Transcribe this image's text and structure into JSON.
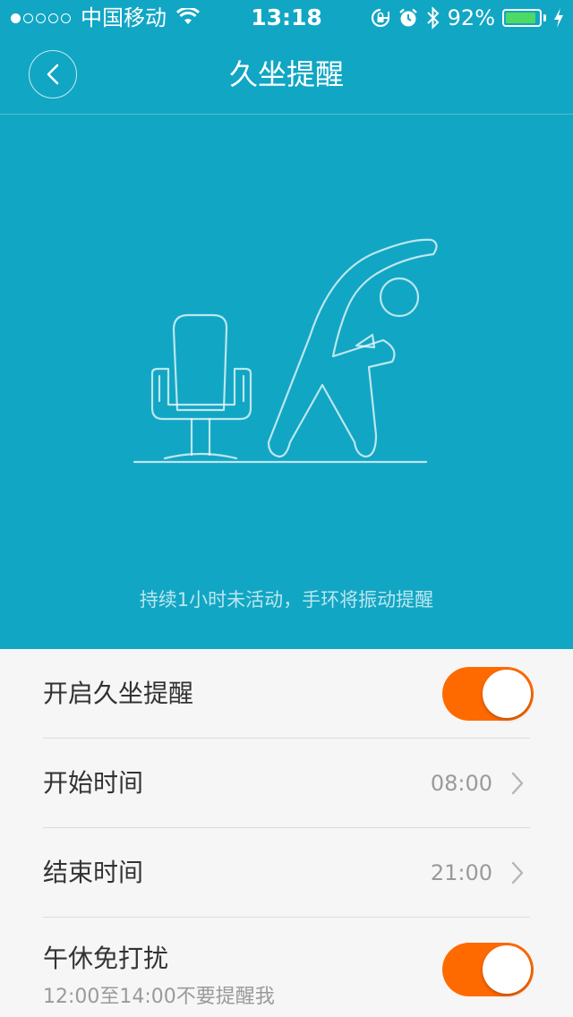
{
  "status_bar": {
    "carrier": "中国移动",
    "time": "13:18",
    "battery_percent": "92%",
    "battery_level": 0.92,
    "signal_bars_filled": 1,
    "signal_bars_total": 5,
    "icons": [
      "wifi-icon",
      "rotation-lock-icon",
      "alarm-icon",
      "bluetooth-icon",
      "battery-icon",
      "charging-icon"
    ],
    "battery_color": "#4cd964"
  },
  "nav": {
    "title": "久坐提醒",
    "back_icon": "chevron-left-icon"
  },
  "hero": {
    "caption": "持续1小时未活动，手环将振动提醒",
    "illustration": "chair-and-stretching-person",
    "background_color": "#11a6c4"
  },
  "settings": {
    "enable": {
      "label": "开启久坐提醒",
      "toggle_on": true
    },
    "start_time": {
      "label": "开始时间",
      "value": "08:00"
    },
    "end_time": {
      "label": "结束时间",
      "value": "21:00"
    },
    "noon_dnd": {
      "label": "午休免打扰",
      "sublabel": "12:00至14:00不要提醒我",
      "toggle_on": true
    }
  },
  "colors": {
    "accent": "#11a6c4",
    "toggle_on": "#ff6a00",
    "list_background": "#f6f6f6"
  }
}
